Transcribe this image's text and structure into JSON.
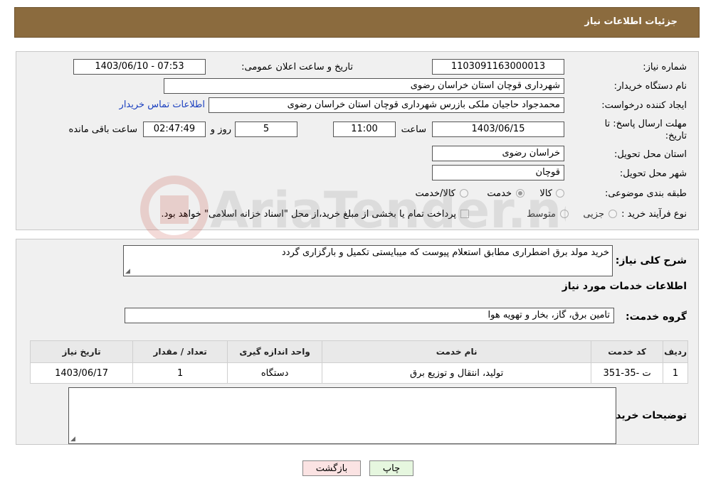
{
  "header": {
    "title": "جزئیات اطلاعات نیاز"
  },
  "details": {
    "need_number_label": "شماره نیاز:",
    "need_number": "1103091163000013",
    "announce_label": "تاریخ و ساعت اعلان عمومی:",
    "announce_value": "1403/06/10 - 07:53",
    "buyer_org_label": "نام دستگاه خریدار:",
    "buyer_org": "شهرداری قوچان استان خراسان رضوی",
    "requester_label": "ایجاد کننده درخواست:",
    "requester": "محمدجواد حاجیان ملکی بازرس شهرداری قوچان استان خراسان رضوی",
    "contact_link": "اطلاعات تماس خریدار",
    "deadline_label": "مهلت ارسال پاسخ: تا تاریخ:",
    "deadline_date": "1403/06/15",
    "time_label": "ساعت",
    "deadline_time": "11:00",
    "days_value": "5",
    "days_label": "روز و",
    "remaining_time": "02:47:49",
    "remaining_label": "ساعت باقی مانده",
    "province_label": "استان محل تحویل:",
    "province": "خراسان رضوی",
    "city_label": "شهر محل تحویل:",
    "city": "قوچان",
    "category_label": "طبقه بندی موضوعی:",
    "category_options": [
      {
        "label": "کالا",
        "selected": false
      },
      {
        "label": "خدمت",
        "selected": true
      },
      {
        "label": "کالا/خدمت",
        "selected": false
      }
    ],
    "purchase_type_label": "نوع فرآیند خرید :",
    "purchase_options": [
      {
        "label": "جزیی",
        "selected": false
      },
      {
        "label": "متوسط",
        "selected": false
      }
    ],
    "payment_note": "پرداخت تمام یا بخشی از مبلغ خرید،از محل \"اسناد خزانه اسلامی\" خواهد بود."
  },
  "description": {
    "label": "شرح کلی نیاز:",
    "value": "خرید مولد برق اضطراری مطابق استعلام پیوست که میبایستی تکمیل و بارگزاری گردد"
  },
  "services": {
    "section_title": "اطلاعات خدمات مورد نیاز",
    "group_label": "گروه خدمت:",
    "group_value": "تامین برق، گاز، بخار و تهویه هوا",
    "table": {
      "headers": [
        "ردیف",
        "کد خدمت",
        "نام خدمت",
        "واحد اندازه گیری",
        "تعداد / مقدار",
        "تاریخ نیاز"
      ],
      "rows": [
        [
          "1",
          "ت -35-351",
          "تولید، انتقال و توزیع برق",
          "دستگاه",
          "1",
          "1403/06/17"
        ]
      ]
    },
    "buyer_notes_label": "توضیحات خریدار:",
    "buyer_notes_value": ""
  },
  "buttons": {
    "print": "چاپ",
    "back": "بازگشت"
  },
  "watermark": {
    "text": "AriaTender.neT"
  },
  "colors": {
    "header_bg": "#8b6b3e",
    "link": "#1a3fbf",
    "back_btn_bg": "#fbe3e3",
    "print_btn_bg": "#e6f7df"
  }
}
